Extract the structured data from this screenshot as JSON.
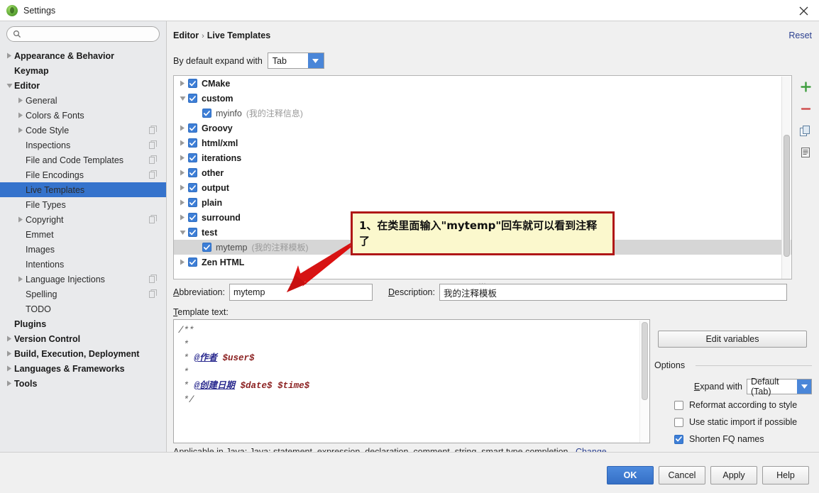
{
  "window": {
    "title": "Settings",
    "app_icon": "intellij-idea-icon",
    "close_icon": "close-icon"
  },
  "sidebar": {
    "search": {
      "value": "",
      "placeholder": "",
      "icon": "search-icon"
    },
    "items": [
      {
        "label": "Appearance & Behavior",
        "level": 0,
        "twisty": "collapsed",
        "selected": false,
        "badge": false
      },
      {
        "label": "Keymap",
        "level": 0,
        "twisty": "none",
        "selected": false,
        "badge": false
      },
      {
        "label": "Editor",
        "level": 0,
        "twisty": "expanded",
        "selected": false,
        "badge": false
      },
      {
        "label": "General",
        "level": 1,
        "twisty": "collapsed",
        "selected": false,
        "badge": false
      },
      {
        "label": "Colors & Fonts",
        "level": 1,
        "twisty": "collapsed",
        "selected": false,
        "badge": false
      },
      {
        "label": "Code Style",
        "level": 1,
        "twisty": "collapsed",
        "selected": false,
        "badge": true
      },
      {
        "label": "Inspections",
        "level": 1,
        "twisty": "none",
        "selected": false,
        "badge": true
      },
      {
        "label": "File and Code Templates",
        "level": 1,
        "twisty": "none",
        "selected": false,
        "badge": true
      },
      {
        "label": "File Encodings",
        "level": 1,
        "twisty": "none",
        "selected": false,
        "badge": true
      },
      {
        "label": "Live Templates",
        "level": 1,
        "twisty": "none",
        "selected": true,
        "badge": false
      },
      {
        "label": "File Types",
        "level": 1,
        "twisty": "none",
        "selected": false,
        "badge": false
      },
      {
        "label": "Copyright",
        "level": 1,
        "twisty": "collapsed",
        "selected": false,
        "badge": true
      },
      {
        "label": "Emmet",
        "level": 1,
        "twisty": "none",
        "selected": false,
        "badge": false
      },
      {
        "label": "Images",
        "level": 1,
        "twisty": "none",
        "selected": false,
        "badge": false
      },
      {
        "label": "Intentions",
        "level": 1,
        "twisty": "none",
        "selected": false,
        "badge": false
      },
      {
        "label": "Language Injections",
        "level": 1,
        "twisty": "collapsed",
        "selected": false,
        "badge": true
      },
      {
        "label": "Spelling",
        "level": 1,
        "twisty": "none",
        "selected": false,
        "badge": true
      },
      {
        "label": "TODO",
        "level": 1,
        "twisty": "none",
        "selected": false,
        "badge": false
      },
      {
        "label": "Plugins",
        "level": 0,
        "twisty": "none",
        "selected": false,
        "badge": false
      },
      {
        "label": "Version Control",
        "level": 0,
        "twisty": "collapsed",
        "selected": false,
        "badge": false
      },
      {
        "label": "Build, Execution, Deployment",
        "level": 0,
        "twisty": "collapsed",
        "selected": false,
        "badge": false
      },
      {
        "label": "Languages & Frameworks",
        "level": 0,
        "twisty": "collapsed",
        "selected": false,
        "badge": false
      },
      {
        "label": "Tools",
        "level": 0,
        "twisty": "collapsed",
        "selected": false,
        "badge": false
      }
    ]
  },
  "main": {
    "breadcrumb": {
      "root": "Editor",
      "separator": "›",
      "leaf": "Live Templates"
    },
    "reset_label": "Reset",
    "expand_with": {
      "label": "By default expand with",
      "value": "Tab"
    },
    "template_tree": [
      {
        "name": "CMake",
        "desc": "",
        "twisty": "collapsed",
        "child": false,
        "checked": true,
        "selected": false
      },
      {
        "name": "custom",
        "desc": "",
        "twisty": "expanded",
        "child": false,
        "checked": true,
        "selected": false
      },
      {
        "name": "myinfo",
        "desc": "(我的注释信息)",
        "twisty": "none",
        "child": true,
        "checked": true,
        "selected": false
      },
      {
        "name": "Groovy",
        "desc": "",
        "twisty": "collapsed",
        "child": false,
        "checked": true,
        "selected": false
      },
      {
        "name": "html/xml",
        "desc": "",
        "twisty": "collapsed",
        "child": false,
        "checked": true,
        "selected": false
      },
      {
        "name": "iterations",
        "desc": "",
        "twisty": "collapsed",
        "child": false,
        "checked": true,
        "selected": false
      },
      {
        "name": "other",
        "desc": "",
        "twisty": "collapsed",
        "child": false,
        "checked": true,
        "selected": false
      },
      {
        "name": "output",
        "desc": "",
        "twisty": "collapsed",
        "child": false,
        "checked": true,
        "selected": false
      },
      {
        "name": "plain",
        "desc": "",
        "twisty": "collapsed",
        "child": false,
        "checked": true,
        "selected": false
      },
      {
        "name": "surround",
        "desc": "",
        "twisty": "collapsed",
        "child": false,
        "checked": true,
        "selected": false
      },
      {
        "name": "test",
        "desc": "",
        "twisty": "expanded",
        "child": false,
        "checked": true,
        "selected": false
      },
      {
        "name": "mytemp",
        "desc": "(我的注释模板)",
        "twisty": "none",
        "child": true,
        "checked": true,
        "selected": true
      },
      {
        "name": "Zen HTML",
        "desc": "",
        "twisty": "collapsed",
        "child": false,
        "checked": true,
        "selected": false
      }
    ],
    "toolbar": [
      {
        "icon": "add-icon",
        "name": "add-template-button"
      },
      {
        "icon": "remove-icon",
        "name": "remove-template-button"
      },
      {
        "icon": "copy-icon",
        "name": "copy-template-button"
      },
      {
        "icon": "duplicate-icon",
        "name": "duplicate-template-button"
      }
    ],
    "abbreviation": {
      "label": "Abbreviation:",
      "value": "mytemp"
    },
    "description": {
      "label": "Description:",
      "value": "我的注释模板"
    },
    "template_text": {
      "label": "Template text:",
      "lines": [
        "/**",
        " *",
        " * @作者 $user$",
        " *",
        " * @创建日期 $date$ $time$",
        " */"
      ]
    },
    "edit_variables_label": "Edit variables",
    "options": {
      "title": "Options",
      "expand_with": {
        "label": "Expand with",
        "value": "Default (Tab)"
      },
      "checkboxes": [
        {
          "label": "Reformat according to style",
          "checked": false
        },
        {
          "label": "Use static import if possible",
          "checked": false
        },
        {
          "label": "Shorten FQ names",
          "checked": true
        }
      ]
    },
    "applicable": {
      "text": "Applicable in Java; Java: statement, expression, declaration, comment, string, smart type completion...",
      "change_label": "Change"
    }
  },
  "footer": {
    "buttons": [
      {
        "label": "OK",
        "primary": true
      },
      {
        "label": "Cancel",
        "primary": false
      },
      {
        "label": "Apply",
        "primary": false
      },
      {
        "label": "Help",
        "primary": false
      }
    ]
  },
  "annotation": {
    "callout_text": "1、在类里面输入\"mytemp\"回车就可以看到注释了",
    "arrow": "red-arrow"
  },
  "colors": {
    "accent_blue": "#3573cc",
    "checkbox_blue": "#3d7ed6",
    "link_blue": "#2a3f8f",
    "callout_bg": "#fbf8cd",
    "callout_border": "#b01717",
    "selected_row": "#d6d6d6"
  }
}
